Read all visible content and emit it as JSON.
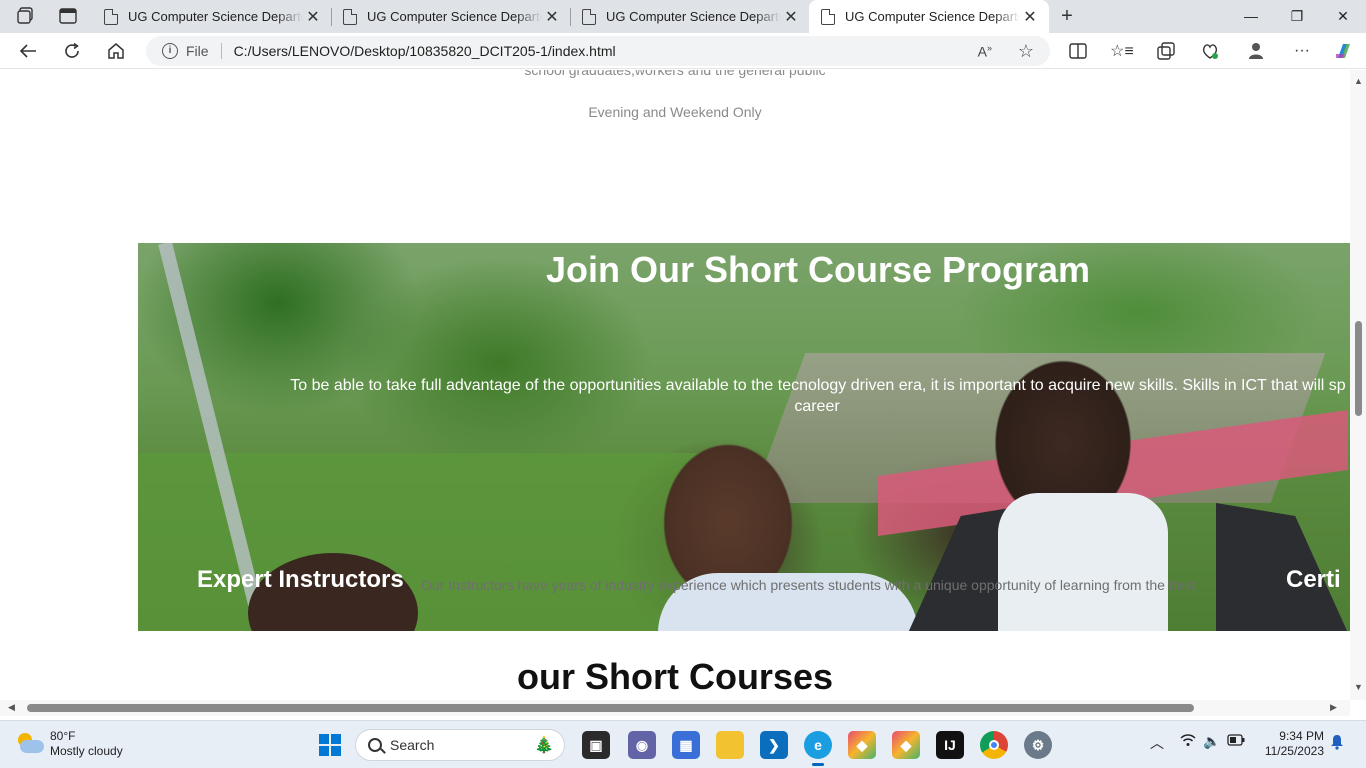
{
  "browser": {
    "tabs": [
      {
        "title": "UG Computer Science Departement",
        "active": false
      },
      {
        "title": "UG Computer Science Departement",
        "active": false
      },
      {
        "title": "UG Computer Science Departement",
        "active": false
      },
      {
        "title": "UG Computer Science Departement",
        "active": true
      }
    ],
    "new_tab_label": "+",
    "address": {
      "scheme_label": "File",
      "url": "C:/Users/LENOVO/Desktop/10835820_DCIT205-1/index.html"
    },
    "window_controls": {
      "minimize": "—",
      "maximize": "❐",
      "close": "✕"
    }
  },
  "page": {
    "cut_subtitle": "school graduates,workers and the general public",
    "schedule": "Evening and Weekend Only",
    "hero": {
      "title": "Join Our Short Course Program",
      "text_line1": "To be able to take full advantage of the opportunities available to the tecnology driven era, it is important to acquire new skills. Skills in ICT that will sp",
      "text_line2": "career",
      "feature1_title": "Expert Instructors",
      "feature1_text": "Our Instructors have years of industry experience which presents students with a unique opportunity of learning from the best.",
      "feature2_title": "Certi"
    },
    "courses_heading": "our Short Courses"
  },
  "taskbar": {
    "weather_temp": "80°F",
    "weather_desc": "Mostly cloudy",
    "search_label": "Search",
    "time": "9:34 PM",
    "date": "11/25/2023"
  },
  "colors": {
    "tabbar_bg": "#dfe3e8",
    "taskbar_bg": "#e8eef6",
    "edge_accent": "#0067c0"
  }
}
